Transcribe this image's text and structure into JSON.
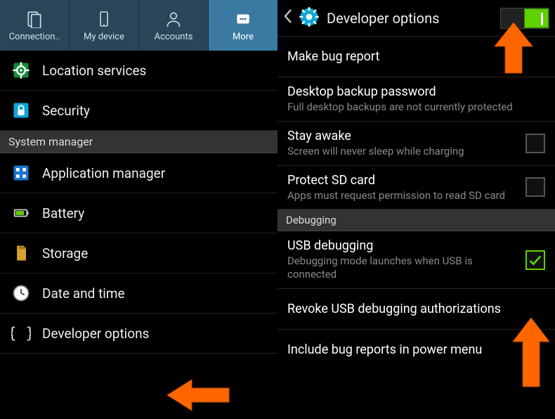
{
  "leftScreen": {
    "tabs": [
      {
        "label": "Connection.."
      },
      {
        "label": "My device"
      },
      {
        "label": "Accounts"
      },
      {
        "label": "More"
      }
    ],
    "sectionHeader": "System manager",
    "items": [
      {
        "label": "Location services"
      },
      {
        "label": "Security"
      },
      {
        "label": "Application manager"
      },
      {
        "label": "Battery"
      },
      {
        "label": "Storage"
      },
      {
        "label": "Date and time"
      },
      {
        "label": "Developer options"
      }
    ]
  },
  "rightScreen": {
    "title": "Developer options",
    "subheader": "Debugging",
    "settings": {
      "bugReport": {
        "title": "Make bug report"
      },
      "desktopBackup": {
        "title": "Desktop backup password",
        "subtitle": "Full desktop backups are not currently protected"
      },
      "stayAwake": {
        "title": "Stay awake",
        "subtitle": "Screen will never sleep while charging"
      },
      "protectSd": {
        "title": "Protect SD card",
        "subtitle": "Apps must request permission to read SD card"
      },
      "usbDebug": {
        "title": "USB debugging",
        "subtitle": "Debugging mode launches when USB is connected"
      },
      "revokeUsb": {
        "title": "Revoke USB debugging authorizations"
      },
      "bugInPower": {
        "title": "Include bug reports in power menu"
      }
    }
  }
}
